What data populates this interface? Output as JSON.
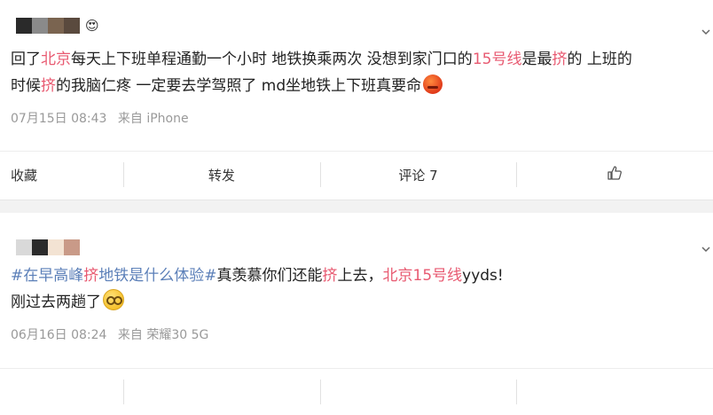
{
  "posts": [
    {
      "avatar_colors": [
        "#2a2a2a",
        "#8a8a8a",
        "#7a6450",
        "#5a4a3e"
      ],
      "text_segments": [
        {
          "t": "回了",
          "k": "n"
        },
        {
          "t": "北京",
          "k": "hl"
        },
        {
          "t": "每天上下班单程通勤一个小时 地铁换乘两次 没想到家门口的",
          "k": "n"
        },
        {
          "t": "15号线",
          "k": "hl"
        },
        {
          "t": "是最",
          "k": "n"
        },
        {
          "t": "挤",
          "k": "hl"
        },
        {
          "t": "的 上班的",
          "k": "n"
        }
      ],
      "text_segments_line2": [
        {
          "t": "时候",
          "k": "n"
        },
        {
          "t": "挤",
          "k": "hl"
        },
        {
          "t": "的我脑仁疼 一定要去学驾照了 md坐地铁上下班真要命",
          "k": "n"
        }
      ],
      "emoji": "angry-face-icon",
      "date": "07月15日 08:43",
      "source": "来自 iPhone",
      "actions": {
        "favorite": "收藏",
        "repost": "转发",
        "comment": "评论 7"
      }
    },
    {
      "avatar_colors": [
        "#d9d9d9",
        "#2b2b2b",
        "#f3e3d3",
        "#c99a88"
      ],
      "line1_segments": [
        {
          "t": "#在早高峰",
          "k": "tag"
        },
        {
          "t": "挤",
          "k": "hl"
        },
        {
          "t": "地铁是什么体验#",
          "k": "tag"
        },
        {
          "t": "真羡慕你们还能",
          "k": "n"
        },
        {
          "t": "挤",
          "k": "hl"
        },
        {
          "t": "上去，",
          "k": "n"
        },
        {
          "t": "北京15号线",
          "k": "hl"
        },
        {
          "t": "yyds!",
          "k": "n"
        }
      ],
      "line2": "刚过去两趟了",
      "emoji": "embarrassed-face-icon",
      "date": "06月16日 08:24",
      "source": "来自 荣耀30 5G"
    }
  ],
  "colors": {
    "highlight": "#e85a71",
    "topic": "#5b7fb8",
    "meta": "#999999"
  }
}
